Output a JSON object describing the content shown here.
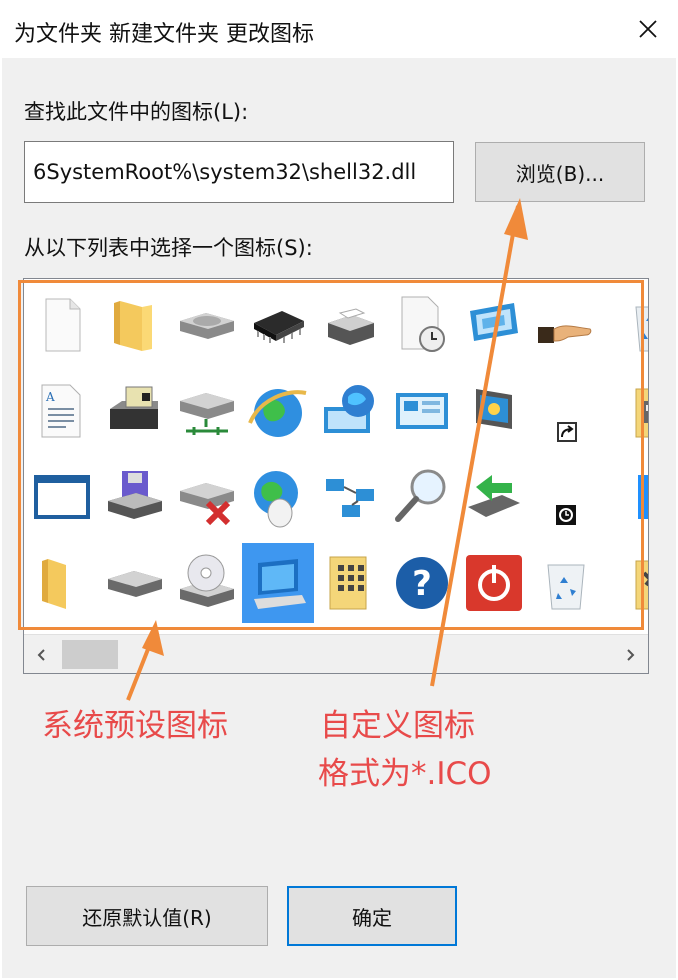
{
  "window": {
    "title": "为文件夹 新建文件夹 更改图标",
    "close_glyph": "✕"
  },
  "labels": {
    "find_in_file": "查找此文件中的图标(L):",
    "select_from_list": "从以下列表中选择一个图标(S):"
  },
  "path_input": {
    "value": "6SystemRoot%\\system32\\shell32.dll"
  },
  "buttons": {
    "browse": "浏览(B)...",
    "restore": "还原默认值(R)",
    "ok": "确定"
  },
  "scrollbar": {
    "left_arrow": "‹",
    "right_arrow": "›"
  },
  "annotations": {
    "system_preset": "系统预设图标",
    "custom_line1": "自定义图标",
    "custom_line2": "格式为*.ICO"
  },
  "colors": {
    "annotation_text": "#e84a4a",
    "callout": "#f08a3a",
    "selection": "#3e97f0",
    "focus_border": "#0078d7"
  },
  "icons": [
    [
      "blank-document-icon",
      "folder-icon",
      "disk-drive-icon",
      "memory-chip-icon",
      "printer-icon",
      "document-clock-icon",
      "display-settings-icon",
      "hand-share-icon",
      "recycle-bin-partial-icon"
    ],
    [
      "text-document-icon",
      "printer-file-icon",
      "network-drive-icon",
      "internet-explorer-globe-icon",
      "network-globe-icon",
      "control-panel-icon",
      "monitor-icon",
      "shortcut-arrow-icon",
      "media-file-partial-icon"
    ],
    [
      "window-icon",
      "floppy-drive-icon",
      "remove-drive-icon",
      "globe-mouse-icon",
      "network-connections-icon",
      "magnifier-icon",
      "usb-arrow-icon",
      "clock-small-icon",
      "blue-tile-partial-icon"
    ],
    [
      "folder-partial-icon",
      "hard-drive-icon",
      "cd-drive-icon",
      "computer-selected-icon",
      "keypad-folder-icon",
      "help-icon",
      "power-icon",
      "recycle-bin-icon",
      "tools-folder-partial-icon"
    ]
  ],
  "selected_icon": "computer-selected-icon"
}
